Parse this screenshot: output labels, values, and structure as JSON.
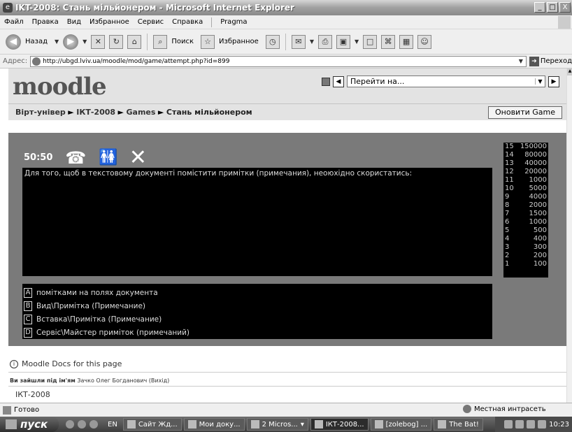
{
  "window": {
    "title": "IKT-2008: Стань мільйонером - Microsoft Internet Explorer"
  },
  "menu": [
    "Файл",
    "Правка",
    "Вид",
    "Избранное",
    "Сервис",
    "Справка",
    "Pragma"
  ],
  "toolbar": {
    "back_label": "Назад",
    "search_label": "Поиск",
    "favorites_label": "Избранное"
  },
  "address": {
    "label": "Адрес:",
    "url": "http://ubgd.lviv.ua/moodle/mod/game/attempt.php?id=899",
    "go_label": "Переход"
  },
  "header": {
    "logo": "moodle",
    "jump_placeholder": "Перейти на..."
  },
  "breadcrumb": {
    "items": [
      "Вірт-універ",
      "ІКТ-2008",
      "Games"
    ],
    "current": "Стань мільйонером",
    "update_button": "Оновити Game"
  },
  "game": {
    "lifelines": {
      "fifty": "50:50"
    },
    "question": "Для того, щоб в текстовому документі помістити примітки (примечания), неоюхідно скористатись:",
    "answers": [
      {
        "key": "A",
        "text": "помітками на полях документа"
      },
      {
        "key": "B",
        "text": "Вид\\Примітка (Примечание)"
      },
      {
        "key": "C",
        "text": "Вставка\\Примітка (Примечание)"
      },
      {
        "key": "D",
        "text": "Сервіс\\Майстер приміток (примечаний)"
      }
    ],
    "ladder": [
      {
        "level": "15",
        "prize": "150000"
      },
      {
        "level": "14",
        "prize": "80000"
      },
      {
        "level": "13",
        "prize": "40000"
      },
      {
        "level": "12",
        "prize": "20000"
      },
      {
        "level": "11",
        "prize": "1000"
      },
      {
        "level": "10",
        "prize": "5000"
      },
      {
        "level": "9",
        "prize": "4000"
      },
      {
        "level": "8",
        "prize": "2000"
      },
      {
        "level": "7",
        "prize": "1500"
      },
      {
        "level": "6",
        "prize": "1000"
      },
      {
        "level": "5",
        "prize": "500"
      },
      {
        "level": "4",
        "prize": "400"
      },
      {
        "level": "3",
        "prize": "300"
      },
      {
        "level": "2",
        "prize": "200"
      },
      {
        "level": "1",
        "prize": "100"
      }
    ]
  },
  "footer": {
    "docs_link": "Moodle Docs for this page",
    "login_prefix": "Ви зайшли під ім'ям",
    "login_user": "Зачко Олег Богданович",
    "logout": "(Вихід)",
    "course": "ІКТ-2008"
  },
  "status": {
    "text": "Готово",
    "zone": "Местная интрасеть"
  },
  "taskbar": {
    "start": "пуск",
    "lang": "EN",
    "tasks": [
      "Сайт Жд...",
      "Мои доку...",
      "2 Micros...",
      "ІКТ-2008...",
      "[zolebog] ...",
      "The Bat!"
    ],
    "clock": "10:23"
  }
}
